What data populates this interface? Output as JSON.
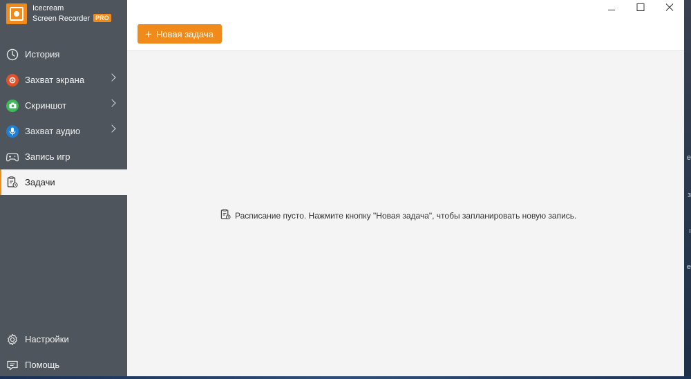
{
  "app": {
    "name_line1": "Icecream",
    "name_line2": "Screen Recorder",
    "badge": "PRO",
    "accent_color": "#ef8a1b"
  },
  "sidebar": {
    "items": [
      {
        "label": "История",
        "icon": "clock-icon"
      },
      {
        "label": "Захват экрана",
        "icon": "record-icon",
        "icon_color": "#e2512a"
      },
      {
        "label": "Скриншот",
        "icon": "camera-icon",
        "icon_color": "#3dbb5b"
      },
      {
        "label": "Захват аудио",
        "icon": "microphone-icon",
        "icon_color": "#1e7fd6"
      },
      {
        "label": "Запись игр",
        "icon": "gamepad-icon"
      },
      {
        "label": "Задачи",
        "icon": "task-list-icon",
        "active": true
      }
    ],
    "bottom_items": [
      {
        "label": "Настройки",
        "icon": "gear-icon"
      },
      {
        "label": "Помощь",
        "icon": "help-icon"
      }
    ]
  },
  "toolbar": {
    "new_task_label": "Новая задача"
  },
  "window_controls": {
    "minimize": "minimize-icon",
    "maximize": "maximize-icon",
    "close": "close-icon"
  },
  "main": {
    "empty_message": "Расписание пусто. Нажмите кнопку \"Новая задача\", чтобы запланировать новую запись."
  }
}
